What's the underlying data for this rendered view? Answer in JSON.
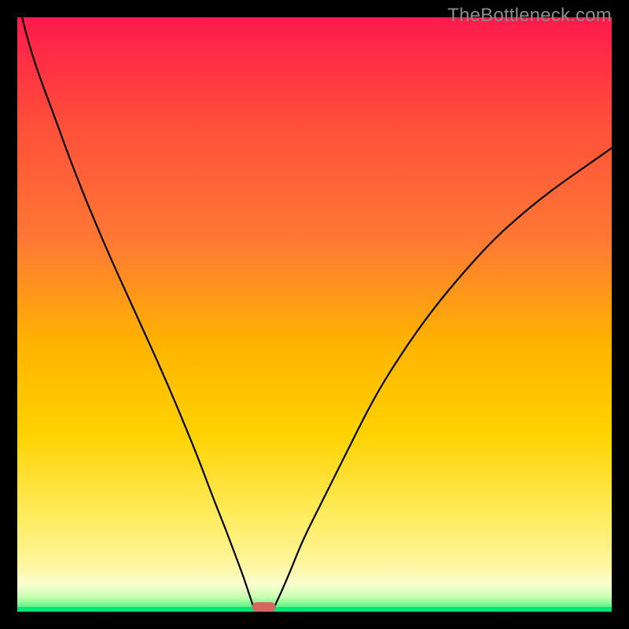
{
  "watermark": "TheBottleneck.com",
  "chart_data": {
    "type": "line",
    "title": "",
    "xlabel": "",
    "ylabel": "",
    "xlim": [
      0,
      100
    ],
    "ylim": [
      0,
      100
    ],
    "gradient_colors": {
      "top": "#ff1a4c",
      "upper_mid": "#ff7a33",
      "mid": "#ffd200",
      "lower_mid": "#fff59e",
      "bottom_band": "#f8ffd0",
      "bottom": "#00e676"
    },
    "series": [
      {
        "name": "left_branch",
        "x": [
          0.0,
          0.7,
          3,
          6,
          10,
          15,
          20,
          25,
          30,
          33,
          35,
          36.5,
          38,
          39,
          39.5,
          39.8,
          40.0
        ],
        "y": [
          104,
          100,
          92,
          84,
          73,
          61,
          50,
          39,
          27,
          19,
          14,
          10,
          6,
          3,
          1.5,
          0.6,
          0.2
        ]
      },
      {
        "name": "right_branch",
        "x": [
          43.0,
          43.2,
          43.6,
          44.5,
          46,
          48,
          51,
          55,
          60,
          65,
          70,
          75,
          80,
          85,
          90,
          95,
          100
        ],
        "y": [
          0.2,
          0.6,
          1.6,
          3.5,
          7,
          12,
          18,
          26,
          36,
          44,
          51,
          57,
          62.5,
          67,
          71,
          74.5,
          78
        ]
      }
    ],
    "marker": {
      "name": "bottleneck-marker",
      "x": 41.5,
      "y": 0.0,
      "width": 4.0,
      "height": 1.6,
      "color": "#d2695e"
    }
  }
}
